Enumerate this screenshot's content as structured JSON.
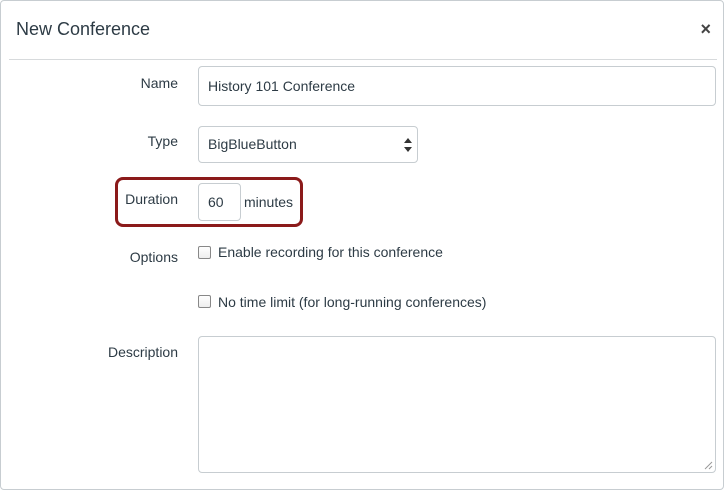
{
  "dialog": {
    "title": "New Conference",
    "close_glyph": "×"
  },
  "form": {
    "name_label": "Name",
    "name_value": "History 101 Conference",
    "type_label": "Type",
    "type_value": "BigBlueButton",
    "duration_label": "Duration",
    "duration_value": "60",
    "duration_unit": "minutes",
    "options_label": "Options",
    "option_recording": "Enable recording for this conference",
    "option_no_time_limit": "No time limit (for long-running conferences)",
    "description_label": "Description",
    "description_value": ""
  },
  "colors": {
    "highlight_border": "#8b1a1a"
  }
}
